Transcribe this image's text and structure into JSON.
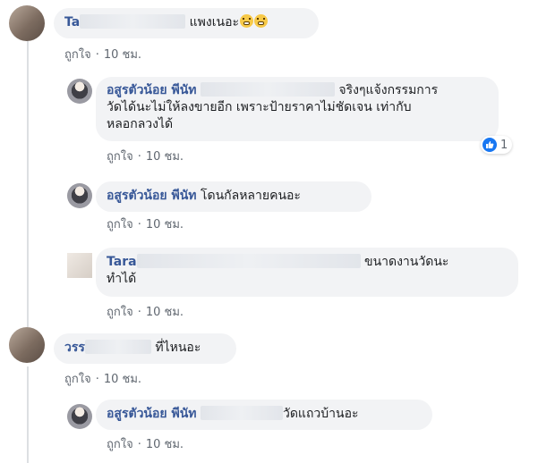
{
  "comments": [
    {
      "author": "Ta",
      "text": "แพงเนอะ",
      "emoji": "grimacing-emoji",
      "actions": {
        "like": "ถูกใจ",
        "time": "10 ชม."
      }
    },
    {
      "author": "อสูรตัวน้อย พีนัท",
      "text_line1": "จริงๆแจ้งกรรมการ",
      "text_line2": "วัดได้นะไม่ให้ลงขายอีก เพราะป้ายราคาไม่ชัดเจน เท่ากับ",
      "text_line3": "หลอกลวงได้",
      "reaction_count": "1",
      "actions": {
        "like": "ถูกใจ",
        "time": "10 ชม."
      }
    },
    {
      "author": "อสูรตัวน้อย พีนัท",
      "text": "โดนกัลหลายคนอะ",
      "actions": {
        "like": "ถูกใจ",
        "time": "10 ชม."
      }
    },
    {
      "author": "Tara",
      "text_line1": "ขนาดงานวัดนะ",
      "text_line2": "ทำได้",
      "actions": {
        "like": "ถูกใจ",
        "time": "10 ชม."
      }
    },
    {
      "author": "วรร",
      "text": "ที่ไหนอะ",
      "actions": {
        "like": "ถูกใจ",
        "time": "10 ชม."
      }
    },
    {
      "author": "อสูรตัวน้อย พีนัท",
      "text": "วัดแถวบ้านอะ",
      "actions": {
        "like": "ถูกใจ",
        "time": "10 ชม."
      }
    }
  ],
  "colors": {
    "author": "#385898",
    "bubble": "#f2f3f5",
    "like_badge": "#1877f2"
  }
}
